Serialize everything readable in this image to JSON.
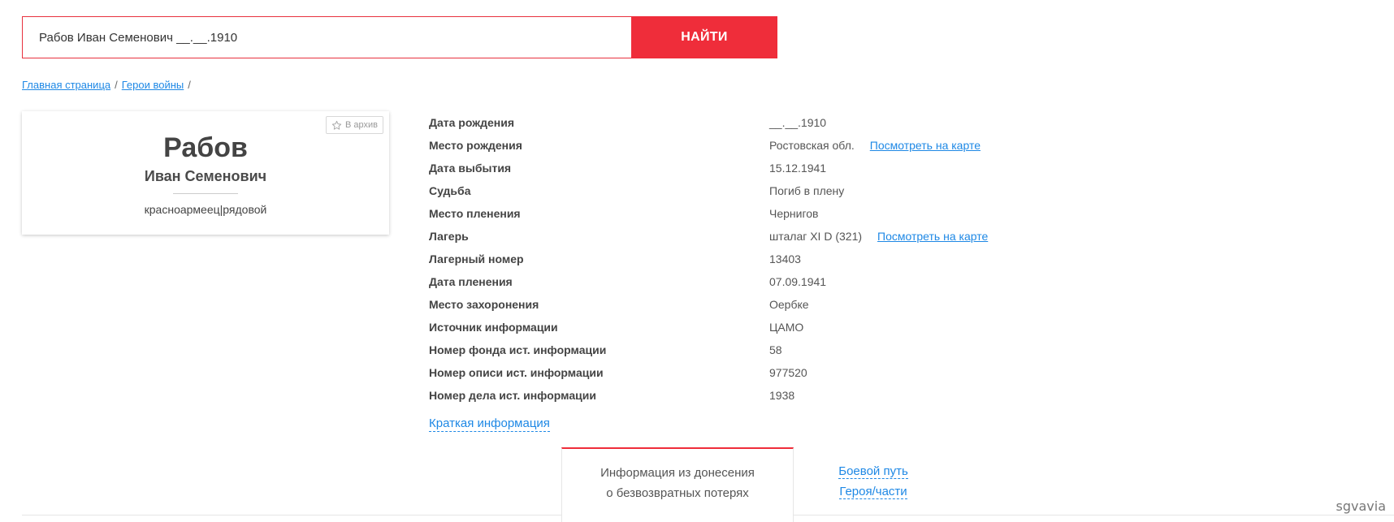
{
  "search": {
    "value": "Рабов Иван Семенович __.__.1910",
    "button_label": "НАЙТИ"
  },
  "breadcrumb": {
    "items": [
      "Главная страница",
      "Герои войны"
    ],
    "separator": "/"
  },
  "hero": {
    "archive_label": "В архив",
    "surname": "Рабов",
    "name": "Иван Семенович",
    "rank": "красноармеец|рядовой"
  },
  "details": [
    {
      "label": "Дата рождения",
      "value": "__.__.1910"
    },
    {
      "label": "Место рождения",
      "value": "Ростовская обл.",
      "link": "Посмотреть на карте"
    },
    {
      "label": "Дата выбытия",
      "value": "15.12.1941"
    },
    {
      "label": "Судьба",
      "value": "Погиб в плену"
    },
    {
      "label": "Место пленения",
      "value": "Чернигов"
    },
    {
      "label": "Лагерь",
      "value": "шталаг XI D (321)",
      "link": "Посмотреть на карте"
    },
    {
      "label": "Лагерный номер",
      "value": "13403"
    },
    {
      "label": "Дата пленения",
      "value": "07.09.1941"
    },
    {
      "label": "Место захоронения",
      "value": "Оербке"
    },
    {
      "label": "Источник информации",
      "value": "ЦАМО"
    },
    {
      "label": "Номер фонда ист. информации",
      "value": "58"
    },
    {
      "label": "Номер описи ист. информации",
      "value": "977520"
    },
    {
      "label": "Номер дела ист. информации",
      "value": "1938"
    }
  ],
  "brief_link": "Краткая информация",
  "tabs": {
    "active": {
      "line1": "Информация из донесения",
      "line2": "о безвозвратных потерях"
    },
    "inactive": {
      "line1": "Боевой путь",
      "line2": "Героя/части"
    }
  },
  "watermark": "sgvavia",
  "colors": {
    "accent_red": "#ef2d3a",
    "link_blue": "#1e88e5"
  }
}
